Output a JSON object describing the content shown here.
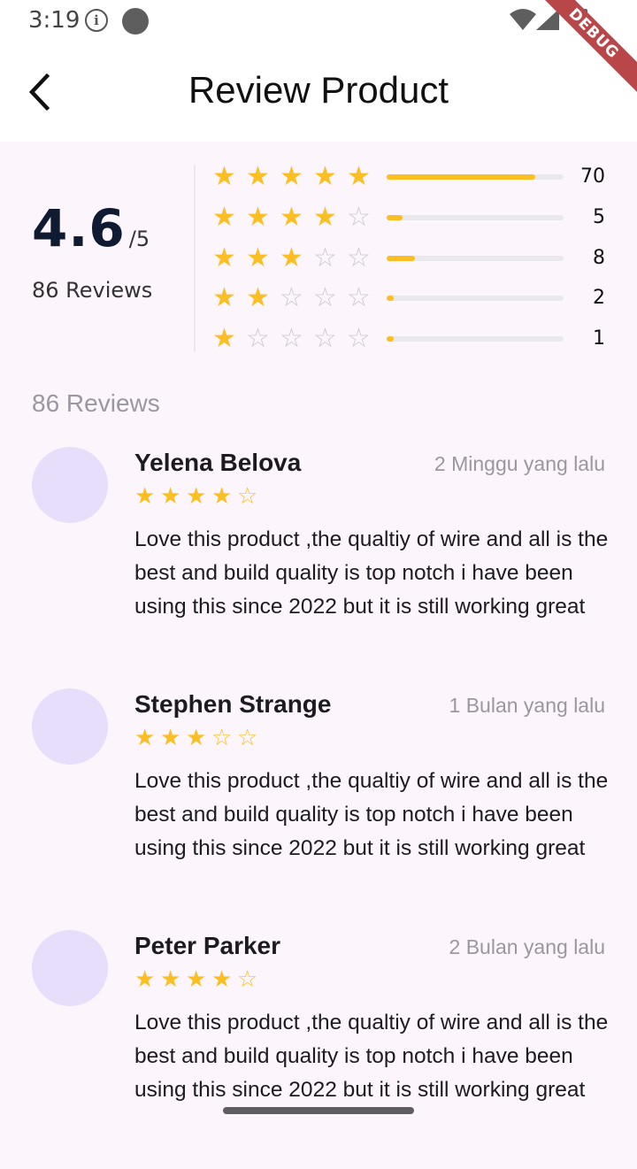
{
  "status_bar": {
    "time": "3:19",
    "debug_label": "DEBUG",
    "icons": [
      "info-icon",
      "dot-icon",
      "wifi-icon",
      "signal-icon",
      "battery-icon"
    ]
  },
  "app_bar": {
    "title": "Review Product",
    "back_icon": "chevron-left-icon"
  },
  "summary": {
    "average": "4.6",
    "out_of": "/5",
    "count_label": "86 Reviews",
    "distribution": [
      {
        "stars": 5,
        "count": "70",
        "fraction": 0.84
      },
      {
        "stars": 4,
        "count": "5",
        "fraction": 0.09
      },
      {
        "stars": 3,
        "count": "8",
        "fraction": 0.16
      },
      {
        "stars": 2,
        "count": "2",
        "fraction": 0.04
      },
      {
        "stars": 1,
        "count": "1",
        "fraction": 0.04
      }
    ]
  },
  "reviews_heading": "86 Reviews",
  "reviews": [
    {
      "name": "Yelena Belova",
      "date": "2 Minggu yang lalu",
      "rating": 4,
      "text": "Love this product ,the qualtiy of wire and all is the best and build quality is top notch i have been using this since 2022 but it is still working great"
    },
    {
      "name": "Stephen Strange",
      "date": "1 Bulan yang lalu",
      "rating": 3,
      "text": "Love this product ,the qualtiy of wire and all is the best and build quality is top notch i have been using this since 2022 but it is still working great"
    },
    {
      "name": "Peter Parker",
      "date": "2 Bulan yang lalu",
      "rating": 4,
      "text": "Love this product ,the qualtiy of wire and all is the best and build quality is top notch i have been using this since 2022 but it is still working great"
    }
  ],
  "colors": {
    "star": "#fbbf24",
    "background": "#fcf5fc",
    "avatar": "#e6defa",
    "debug_banner": "#b9474a"
  }
}
